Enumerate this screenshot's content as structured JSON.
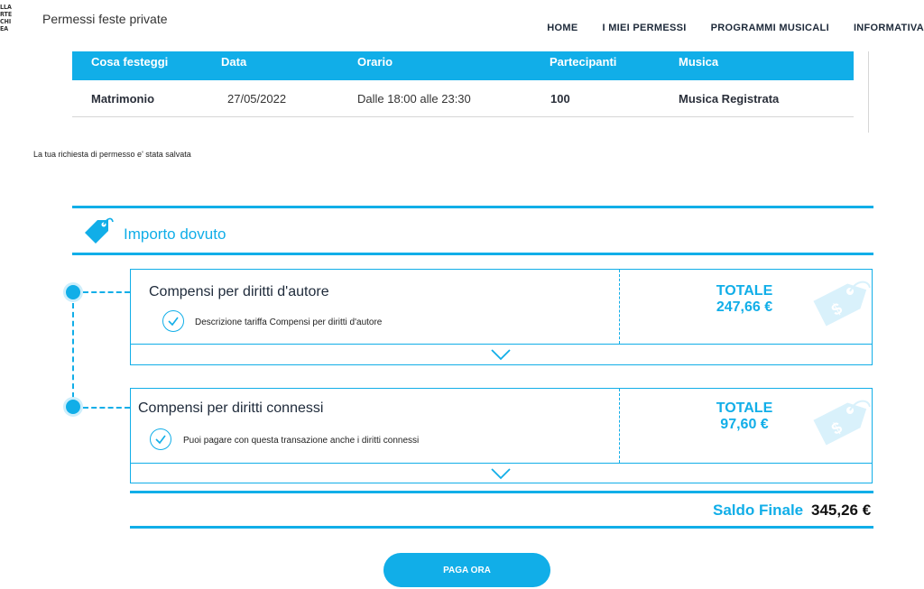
{
  "logo_lines": [
    "LLA",
    "RTE",
    "CHI",
    "EA"
  ],
  "app_title": "Permessi feste private",
  "nav": [
    "HOME",
    "I MIEI PERMESSI",
    "PROGRAMMI MUSICALI",
    "INFORMATIVA"
  ],
  "table": {
    "headers": [
      "Cosa festeggi",
      "Data",
      "Orario",
      "Partecipanti",
      "Musica"
    ],
    "row": [
      "Matrimonio",
      "27/05/2022",
      "Dalle 18:00 alle 23:30",
      "100",
      "Musica Registrata"
    ]
  },
  "saved_message": "La tua richiesta di permesso e' stata salvata",
  "section_title": "Importo dovuto",
  "cards": [
    {
      "name": "Compensi per diritti d'autore",
      "description": "Descrizione tariffa Compensi per diritti d'autore",
      "total_label": "TOTALE",
      "total_value": "247,66 €"
    },
    {
      "name": "Compensi per diritti connessi",
      "description": "Puoi pagare con questa transazione anche i diritti connessi",
      "total_label": "TOTALE",
      "total_value": "97,60 €"
    }
  ],
  "saldo": {
    "label": "Saldo Finale",
    "value": "345,26 €"
  },
  "pay_button": "PAGA ORA",
  "colors": {
    "accent": "#11aee8",
    "text_dark": "#1e2a3a"
  },
  "icons": [
    "price-tag-icon",
    "check-circle-icon",
    "chevron-down-icon",
    "dollar-tag-icon"
  ]
}
